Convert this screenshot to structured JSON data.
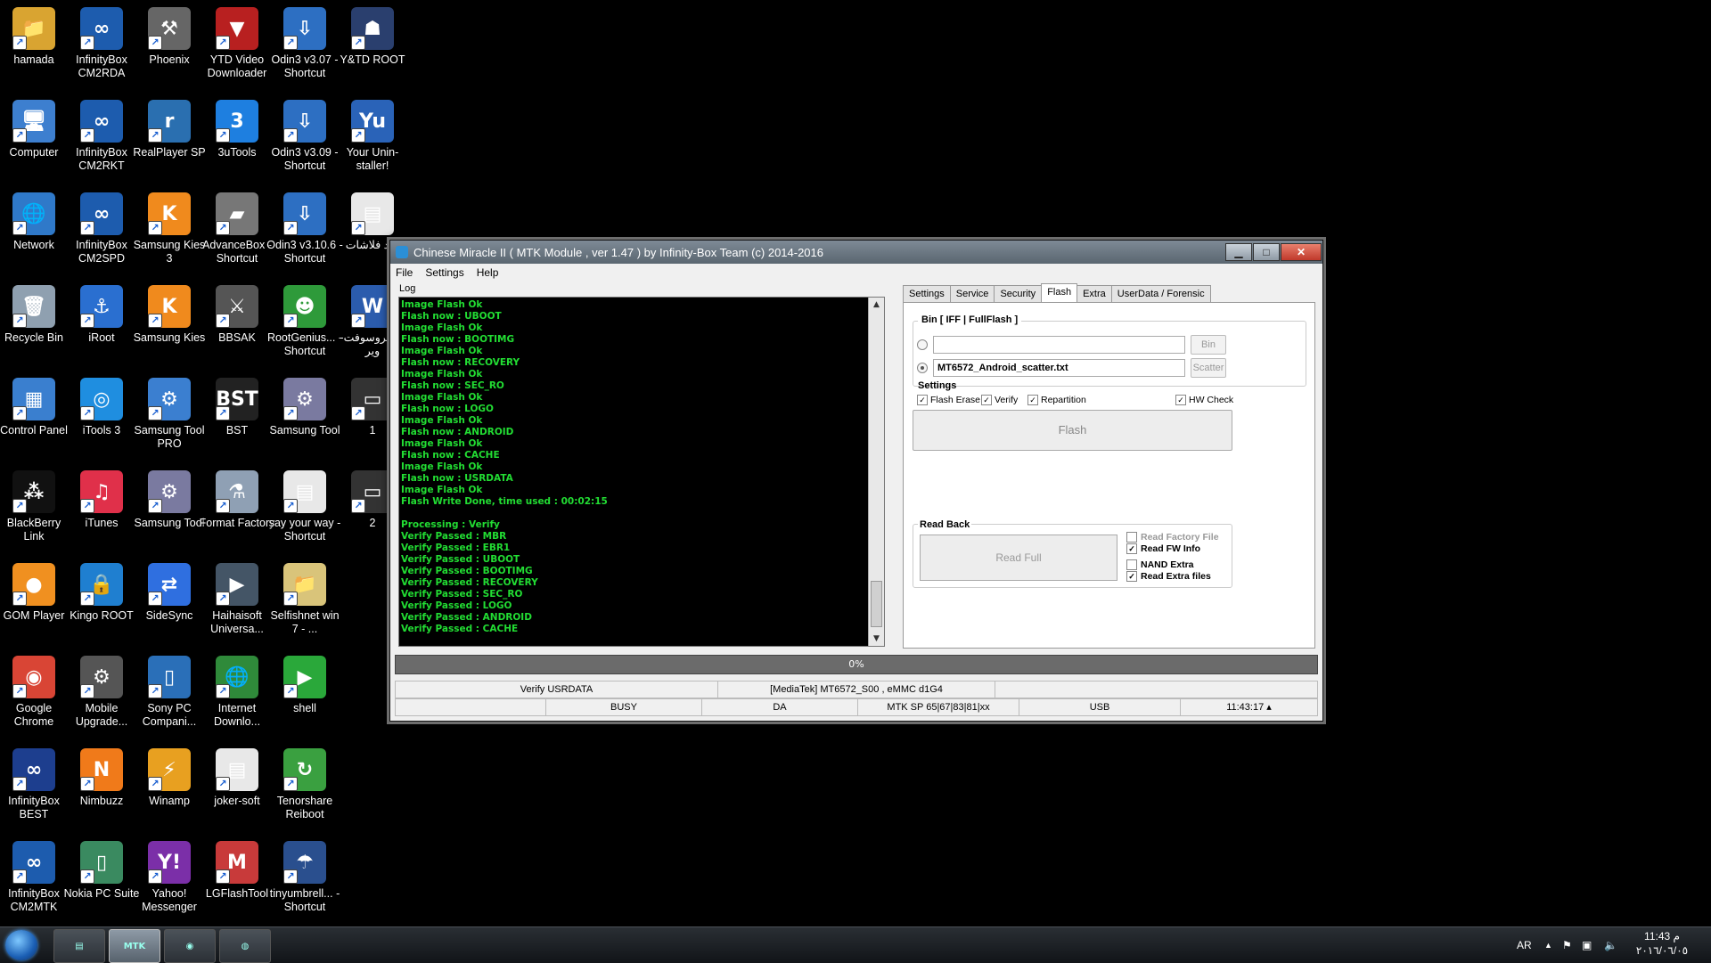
{
  "desktop": {
    "icons": [
      {
        "label": "hamada",
        "icon": "folder-icon",
        "color": "#d9a431",
        "glyph": "📁"
      },
      {
        "label": "InfinityBox CM2RDA",
        "icon": "infinitybox-rda-icon",
        "color": "#1d5cae",
        "glyph": "∞"
      },
      {
        "label": "Phoenix",
        "icon": "phoenix-tool-icon",
        "color": "#666666",
        "glyph": "⚒"
      },
      {
        "label": "YTD Video Downloader",
        "icon": "ytd-icon",
        "color": "#b82020",
        "glyph": "▼"
      },
      {
        "label": "Odin3 v3.07 - Shortcut",
        "icon": "odin-icon",
        "color": "#2d6fc2",
        "glyph": "⇩"
      },
      {
        "label": "Y&TD ROOT",
        "icon": "android-root-icon",
        "color": "#2a3f6e",
        "glyph": "☗"
      },
      {
        "label": "Computer",
        "icon": "computer-icon",
        "color": "#3d7fcf",
        "glyph": "🖥"
      },
      {
        "label": "InfinityBox CM2RKT",
        "icon": "infinitybox-rkt-icon",
        "color": "#1d5cae",
        "glyph": "∞"
      },
      {
        "label": "RealPlayer SP",
        "icon": "realplayer-icon",
        "color": "#2a6fb0",
        "glyph": "r"
      },
      {
        "label": "3uTools",
        "icon": "3utools-icon",
        "color": "#1e7fe0",
        "glyph": "3"
      },
      {
        "label": "Odin3 v3.09 - Shortcut",
        "icon": "odin-icon",
        "color": "#2d6fc2",
        "glyph": "⇩"
      },
      {
        "label": "Your Unin-staller!",
        "icon": "uninstaller-icon",
        "color": "#2a63b8",
        "glyph": "Yu"
      },
      {
        "label": "Network",
        "icon": "network-icon",
        "color": "#2f79c9",
        "glyph": "🌐"
      },
      {
        "label": "InfinityBox CM2SPD",
        "icon": "infinitybox-spd-icon",
        "color": "#1d5cae",
        "glyph": "∞"
      },
      {
        "label": "Samsung Kies 3",
        "icon": "kies-icon",
        "color": "#f08a1d",
        "glyph": "K"
      },
      {
        "label": "AdvanceBox - Shortcut",
        "icon": "advancebox-icon",
        "color": "#777777",
        "glyph": "▰"
      },
      {
        "label": "Odin3 v3.10.6 - Shortcut",
        "icon": "odin-icon",
        "color": "#2d6fc2",
        "glyph": "⇩"
      },
      {
        "label": "ورد فلاشات",
        "icon": "document-icon",
        "color": "#e8e8e8",
        "glyph": "▤"
      },
      {
        "label": "Recycle Bin",
        "icon": "recycle-bin-icon",
        "color": "#8fa0b0",
        "glyph": "🗑"
      },
      {
        "label": "iRoot",
        "icon": "iroot-icon",
        "color": "#2a6fd0",
        "glyph": "⚓"
      },
      {
        "label": "Samsung Kies",
        "icon": "kies-icon",
        "color": "#f08a1d",
        "glyph": "K"
      },
      {
        "label": "BBSAK",
        "icon": "bbsak-icon",
        "color": "#555555",
        "glyph": "⚔"
      },
      {
        "label": "RootGenius... - Shortcut",
        "icon": "rootgenius-icon",
        "color": "#2e9a3a",
        "glyph": "☻"
      },
      {
        "label": "مايكروسوفت-وير",
        "icon": "word-icon",
        "color": "#2b5cad",
        "glyph": "W"
      },
      {
        "label": "Control Panel",
        "icon": "control-panel-icon",
        "color": "#3a7fcf",
        "glyph": "▦"
      },
      {
        "label": "iTools 3",
        "icon": "itools-icon",
        "color": "#1f8ee0",
        "glyph": "◎"
      },
      {
        "label": "Samsung Tool PRO",
        "icon": "gear-icon",
        "color": "#3b7fd0",
        "glyph": "⚙"
      },
      {
        "label": "BST",
        "icon": "bst-icon",
        "color": "#222222",
        "glyph": "BST"
      },
      {
        "label": "Samsung Tool",
        "icon": "gear-icon",
        "color": "#7a7aa0",
        "glyph": "⚙"
      },
      {
        "label": "1",
        "icon": "shortcut-file-icon",
        "color": "#333333",
        "glyph": "▭"
      },
      {
        "label": "BlackBerry Link",
        "icon": "blackberry-icon",
        "color": "#111111",
        "glyph": "⁂"
      },
      {
        "label": "iTunes",
        "icon": "itunes-icon",
        "color": "#e0304a",
        "glyph": "♫"
      },
      {
        "label": "Samsung Tool",
        "icon": "gear-icon",
        "color": "#7a7aa0",
        "glyph": "⚙"
      },
      {
        "label": "Format Factory",
        "icon": "format-factory-icon",
        "color": "#8fa0b4",
        "glyph": "⚗"
      },
      {
        "label": "say your way - Shortcut",
        "icon": "document-icon",
        "color": "#e8e8e8",
        "glyph": "▤"
      },
      {
        "label": "2",
        "icon": "shortcut-file-icon",
        "color": "#333333",
        "glyph": "▭"
      },
      {
        "label": "GOM Player",
        "icon": "gom-player-icon",
        "color": "#f09020",
        "glyph": "●"
      },
      {
        "label": "Kingo ROOT",
        "icon": "kingo-root-icon",
        "color": "#1f7fd0",
        "glyph": "🔒"
      },
      {
        "label": "SideSync",
        "icon": "sidesync-icon",
        "color": "#2f6fe0",
        "glyph": "⇄"
      },
      {
        "label": "Haihaisoft Universa...",
        "icon": "video-player-icon",
        "color": "#445566",
        "glyph": "▶"
      },
      {
        "label": "Selfishnet win 7 - ...",
        "icon": "folder-icon",
        "color": "#d9c47a",
        "glyph": "📁"
      },
      {
        "label": "Google Chrome",
        "icon": "chrome-icon",
        "color": "#d94535",
        "glyph": "◉"
      },
      {
        "label": "Mobile Upgrade...",
        "icon": "gear-icon",
        "color": "#555555",
        "glyph": "⚙"
      },
      {
        "label": "Sony PC Compani...",
        "icon": "sony-pc-icon",
        "color": "#2a6fb8",
        "glyph": "▯"
      },
      {
        "label": "Internet Downlo...",
        "icon": "idm-icon",
        "color": "#2f8a3a",
        "glyph": "🌐"
      },
      {
        "label": "shell",
        "icon": "play-arrow-icon",
        "color": "#2aa83a",
        "glyph": "▶"
      },
      {
        "label": "InfinityBox BEST",
        "icon": "infinitybox-best-icon",
        "color": "#1d3e8e",
        "glyph": "∞"
      },
      {
        "label": "Nimbuzz",
        "icon": "nimbuzz-icon",
        "color": "#f07a1a",
        "glyph": "N"
      },
      {
        "label": "Winamp",
        "icon": "winamp-icon",
        "color": "#e8a020",
        "glyph": "⚡"
      },
      {
        "label": "joker-soft",
        "icon": "document-icon",
        "color": "#e8e8e8",
        "glyph": "▤"
      },
      {
        "label": "Tenorshare Reiboot",
        "icon": "reiboot-icon",
        "color": "#3aa040",
        "glyph": "↻"
      },
      {
        "label": "InfinityBox CM2MTK",
        "icon": "infinitybox-mtk-icon",
        "color": "#1d5cae",
        "glyph": "∞"
      },
      {
        "label": "Nokia PC Suite",
        "icon": "nokia-icon",
        "color": "#3a8a60",
        "glyph": "▯"
      },
      {
        "label": "Yahoo! Messenger",
        "icon": "yahoo-icon",
        "color": "#7b2fa8",
        "glyph": "Y!"
      },
      {
        "label": "LGFlashTool",
        "icon": "lgflash-icon",
        "color": "#c83a3a",
        "glyph": "M"
      },
      {
        "label": "tinyumbrell... - Shortcut",
        "icon": "umbrella-icon",
        "color": "#2a4f8e",
        "glyph": "☂"
      }
    ]
  },
  "window": {
    "title": "Chinese Miracle II ( MTK Module , ver 1.47 ) by Infinity-Box Team (c) 2014-2016",
    "minimize": "▁",
    "maximize": "□",
    "close": "✕",
    "menu": [
      "File",
      "Settings",
      "Help"
    ],
    "log_label": "Log",
    "log_lines": [
      "Image Flash Ok",
      "Flash now : UBOOT",
      "Image Flash Ok",
      "Flash now : BOOTIMG",
      "Image Flash Ok",
      "Flash now : RECOVERY",
      "Image Flash Ok",
      "Flash now : SEC_RO",
      "Image Flash Ok",
      "Flash now : LOGO",
      "Image Flash Ok",
      "Flash now : ANDROID",
      "Image Flash Ok",
      "Flash now : CACHE",
      "Image Flash Ok",
      "Flash now : USRDATA",
      "Image Flash Ok",
      "Flash Write Done, time used : 00:02:15",
      "",
      "Processing : Verify",
      "Verify Passed : MBR",
      "Verify Passed : EBR1",
      "Verify Passed : UBOOT",
      "Verify Passed : BOOTIMG",
      "Verify Passed : RECOVERY",
      "Verify Passed : SEC_RO",
      "Verify Passed : LOGO",
      "Verify Passed : ANDROID",
      "Verify Passed : CACHE"
    ],
    "log_color": "#22dd33",
    "tabs": [
      "Settings",
      "Service",
      "Security",
      "Flash",
      "Extra",
      "UserData / Forensic"
    ],
    "active_tab": "Flash",
    "flash": {
      "bin_legend": "Bin  [ IFF | FullFlash ]",
      "bin_path": "",
      "bin_button": "Bin",
      "scatter_path": "MT6572_Android_scatter.txt",
      "scatter_button": "Scatter",
      "settings_label": "Settings",
      "options": [
        {
          "label": "Flash Erase",
          "checked": true
        },
        {
          "label": "Verify",
          "checked": true
        },
        {
          "label": "Repartition",
          "checked": true
        },
        {
          "label": "HW Check",
          "checked": true
        }
      ],
      "flash_button": "Flash",
      "readback_label": "Read Back",
      "read_full_button": "Read Full",
      "readback_options": [
        {
          "label": "Read Factory File",
          "checked": false,
          "enabled": false
        },
        {
          "label": "Read FW Info",
          "checked": true,
          "enabled": true
        },
        {
          "label": "NAND Extra",
          "checked": false,
          "enabled": true
        },
        {
          "label": "Read Extra files",
          "checked": true,
          "enabled": true
        }
      ]
    },
    "progress_text": "0%",
    "status1": [
      "Verify USRDATA",
      "[MediaTek] MT6572_S00 , eMMC d1G4",
      ""
    ],
    "status2": [
      "",
      "BUSY",
      "DA",
      "MTK SP 65|67|83|81|xx",
      "USB",
      "11:43:17 ▴"
    ]
  },
  "taskbar": {
    "tray_lang": "AR",
    "tray_up": "▲",
    "clock_time": "11:43 م",
    "clock_date": "٢٠١٦/٠٦/٠٥",
    "pinned": [
      {
        "icon": "app-icon-1",
        "label": "▤",
        "active": false
      },
      {
        "icon": "infinitybox-mtk-icon",
        "label": "MTK",
        "active": true
      },
      {
        "icon": "app-icon-3",
        "label": "◉",
        "active": false
      },
      {
        "icon": "app-icon-4",
        "label": "◍",
        "active": false
      }
    ]
  }
}
